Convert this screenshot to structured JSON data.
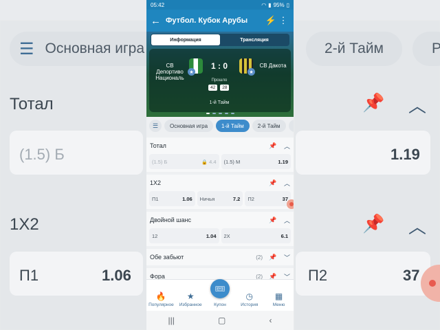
{
  "status_bar": {
    "time": "05:42",
    "battery": "95%"
  },
  "app_bar": {
    "title": "Футбол. Кубок Арубы"
  },
  "tabs": {
    "info": "Информация",
    "stream": "Трансляция"
  },
  "match": {
    "team1": "СВ Депортиво Националь",
    "team2": "СВ Дакота",
    "score": "1 : 0",
    "elapsed_label": "Прошло",
    "minutes": "42",
    "seconds": "28",
    "period": "1-й Тайм"
  },
  "filters": [
    "Основная игра",
    "1-й Тайм",
    "2-й Тайм",
    "Р"
  ],
  "markets": {
    "total": {
      "title": "Тотал",
      "odds": [
        {
          "label": "(1.5) Б",
          "value": "4.4",
          "locked": true
        },
        {
          "label": "(1.5) М",
          "value": "1.19"
        }
      ]
    },
    "x12": {
      "title": "1X2",
      "odds": [
        {
          "label": "П1",
          "value": "1.06"
        },
        {
          "label": "Ничья",
          "value": "7.2"
        },
        {
          "label": "П2",
          "value": "37"
        }
      ]
    },
    "double": {
      "title": "Двойной шанс",
      "odds": [
        {
          "label": "12",
          "value": "1.04"
        },
        {
          "label": "2X",
          "value": "6.1"
        }
      ]
    },
    "both": {
      "title": "Обе забьют",
      "count": "(2)"
    },
    "handicap": {
      "title": "Фора",
      "count": "(2)"
    }
  },
  "bottom_nav": {
    "popular": "Популярное",
    "favorites": "Избранное",
    "coupon": "Купон",
    "history": "История",
    "menu": "Меню"
  },
  "background": {
    "main_game": "Основная игра",
    "second_half": "2-й Тайм",
    "p_letter": "Р",
    "total": "Тотал",
    "over_label": "(1.5) Б",
    "under_value": "1.19",
    "x12": "1X2",
    "p1": "П1",
    "p1_value": "1.06",
    "p2": "П2",
    "p2_value": "37"
  }
}
